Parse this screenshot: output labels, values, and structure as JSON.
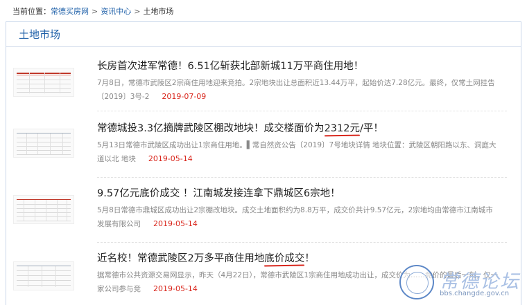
{
  "breadcrumb": {
    "prefix": "当前位置：",
    "links": [
      "常德买房网",
      "资讯中心"
    ],
    "current": "土地市场",
    "separator": ">"
  },
  "panel": {
    "title": "土地市场"
  },
  "articles": [
    {
      "title_before": "长房首次进军常德！6.51亿斩获北部新城11万平商住用地！",
      "title_highlight": "",
      "title_after": "",
      "summary": "7月8日，常德市武陵区2宗商住用地迎来竞拍。2宗地块出让总面积近13.44万平，起始价达7.28亿元。最终，仅常土网挂告〔2019〕3号-2",
      "date": "2019-07-09"
    },
    {
      "title_before": "常德城投3.3亿摘牌武陵区棚改地块！成交楼面价为",
      "title_highlight": "2312元",
      "title_after": "/平！",
      "summary": "5月13日常德市武陵区成功出让1宗商住用地。▌常自然资公告〔2019〕7号地块详情 地块位置：武陵区朝阳路以东、洞庭大道以北 地块",
      "date": "2019-05-14"
    },
    {
      "title_before": "9.57亿元底价成交 ！江南城发接连拿下鼎城区6宗地！",
      "title_highlight": "",
      "title_after": "",
      "summary": "5月8日常德市鼎城区成功出让2宗棚改地块。成交土地面积约为8.8万平，成交价共计9.57亿元，2宗地均由常德市江南城市发展有限公司",
      "date": "2019-05-14"
    },
    {
      "title_before": "近名校！常德武陵区2万多平商住用地",
      "title_highlight": "底价成交",
      "title_after": "！",
      "summary": "据常德市公共资源交易网显示，昨天（4月22日），常德市武陵区1宗商住用地成功出让，成交价为……竞价的最后一刻，仅一家公司参与竞",
      "date": "2019-05-14"
    }
  ],
  "watermark": {
    "title": "常德论坛",
    "url": "bbs.changde.gov.cn"
  },
  "colors": {
    "link": "#1d5fa8",
    "date": "#d9261c",
    "border": "#c9d7ea",
    "underline": "#d9261c"
  }
}
